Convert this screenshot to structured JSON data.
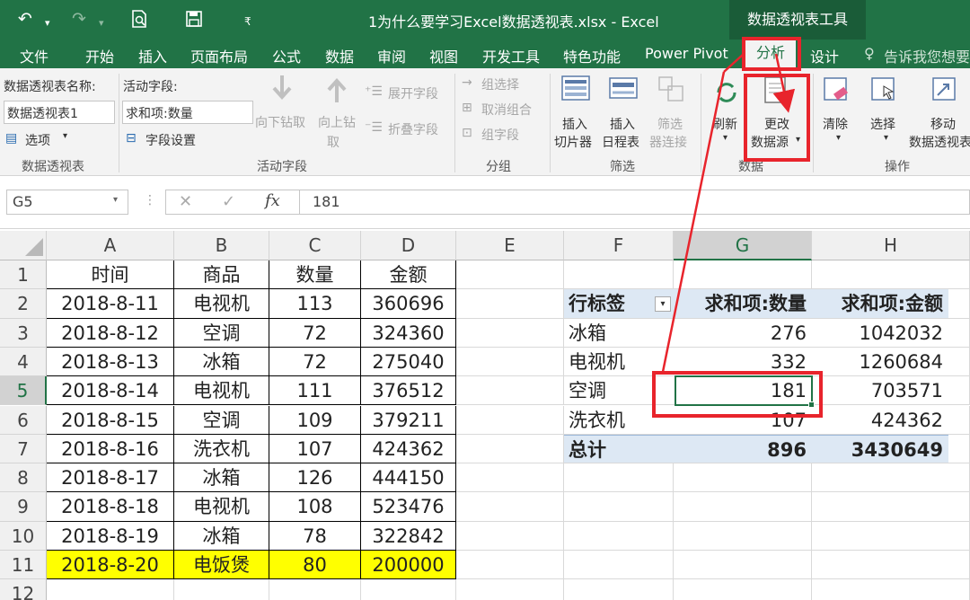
{
  "titlebar": {
    "undo": "↶",
    "redo": "↷",
    "title": "1为什么要学习Excel数据透视表.xlsx - Excel",
    "context_tools": "数据透视表工具"
  },
  "menu": {
    "file": "文件",
    "home": "开始",
    "insert": "插入",
    "layout": "页面布局",
    "formula": "公式",
    "data": "数据",
    "review": "审阅",
    "view": "视图",
    "developer": "开发工具",
    "special": "特色功能",
    "powerpivot": "Power Pivot",
    "analyze": "分析",
    "design": "设计",
    "tell": "告诉我您想要"
  },
  "ribbon": {
    "pt_name_label": "数据透视表名称:",
    "pt_name_value": "数据透视表1",
    "options": "选项",
    "group_pt": "数据透视表",
    "active_field_label": "活动字段:",
    "active_field_value": "求和项:数量",
    "field_settings": "字段设置",
    "drill_down": "向下钻取",
    "drill_up_1": "向上钻",
    "drill_up_2": "取",
    "expand": "展开字段",
    "collapse": "折叠字段",
    "group_active": "活动字段",
    "group_selection": "组选择",
    "ungroup": "取消组合",
    "group_field": "组字段",
    "group_group": "分组",
    "insert_slicer_1": "插入",
    "insert_slicer_2": "切片器",
    "insert_timeline_1": "插入",
    "insert_timeline_2": "日程表",
    "filter_conn_1": "筛选",
    "filter_conn_2": "器连接",
    "group_filter": "筛选",
    "refresh_1": "刷新",
    "change_1": "更改",
    "change_2": "数据源",
    "group_data": "数据",
    "clear": "清除",
    "select": "选择",
    "move_1": "移动",
    "move_2": "数据透视表",
    "group_actions": "操作"
  },
  "formula_bar": {
    "name_box": "G5",
    "fx": "fx",
    "content": "181"
  },
  "columns": [
    "A",
    "B",
    "C",
    "D",
    "E",
    "F",
    "G",
    "H"
  ],
  "rows": [
    "1",
    "2",
    "3",
    "4",
    "5",
    "6",
    "7",
    "8",
    "9",
    "10",
    "11",
    "12"
  ],
  "source_table": {
    "headers": [
      "时间",
      "商品",
      "数量",
      "金额"
    ],
    "rows": [
      [
        "2018-8-11",
        "电视机",
        "113",
        "360696"
      ],
      [
        "2018-8-12",
        "空调",
        "72",
        "324360"
      ],
      [
        "2018-8-13",
        "冰箱",
        "72",
        "275040"
      ],
      [
        "2018-8-14",
        "电视机",
        "111",
        "376512"
      ],
      [
        "2018-8-15",
        "空调",
        "109",
        "379211"
      ],
      [
        "2018-8-16",
        "洗衣机",
        "107",
        "424362"
      ],
      [
        "2018-8-17",
        "冰箱",
        "126",
        "444150"
      ],
      [
        "2018-8-18",
        "电视机",
        "108",
        "523476"
      ],
      [
        "2018-8-19",
        "冰箱",
        "78",
        "322842"
      ],
      [
        "2018-8-20",
        "电饭煲",
        "80",
        "200000"
      ]
    ]
  },
  "pivot": {
    "headers": [
      "行标签",
      "求和项:数量",
      "求和项:金额"
    ],
    "rows": [
      [
        "冰箱",
        "276",
        "1042032"
      ],
      [
        "电视机",
        "332",
        "1260684"
      ],
      [
        "空调",
        "181",
        "703571"
      ],
      [
        "洗衣机",
        "107",
        "424362"
      ]
    ],
    "total": [
      "总计",
      "896",
      "3430649"
    ]
  },
  "colors": {
    "excel_green": "#217346",
    "highlight_yellow": "#ffff00",
    "pivot_header": "#dde8f4",
    "annotation_red": "#e8242c"
  }
}
